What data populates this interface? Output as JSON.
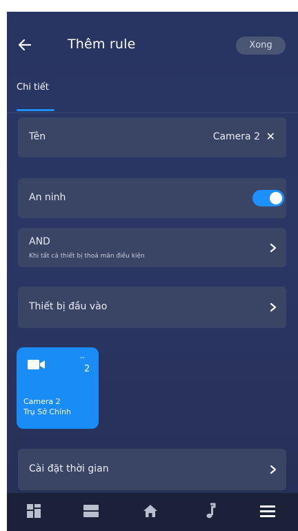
{
  "header": {
    "back_icon": "arrow-left-icon",
    "title": "Thêm rule",
    "done_label": "Xong"
  },
  "tabs": [
    {
      "label": "Chi tiết",
      "active": true
    }
  ],
  "name_row": {
    "label": "Tên",
    "value": "Camera 2",
    "clear_glyph": "✕"
  },
  "security_row": {
    "label": "An ninh",
    "enabled": true
  },
  "and_row": {
    "label": "AND",
    "subtitle": "Khi tất cả thiết bị thoả mãn điều kiện"
  },
  "input_row": {
    "label": "Thiết bị đầu vào"
  },
  "device_tile": {
    "icon": "video-camera-icon",
    "mini_label": "\"\"",
    "count": "2",
    "name": "Camera 2",
    "location": "Trụ Sở Chính"
  },
  "time_row": {
    "label": "Cài đặt thời gian"
  },
  "bottom_nav": [
    "dashboard-grid-icon",
    "list-view-icon",
    "home-icon",
    "music-note-icon",
    "hamburger-menu-icon"
  ],
  "colors": {
    "accent": "#1e8fff",
    "background": "#283461",
    "card": "#3a4565",
    "nav": "#1b2138"
  }
}
